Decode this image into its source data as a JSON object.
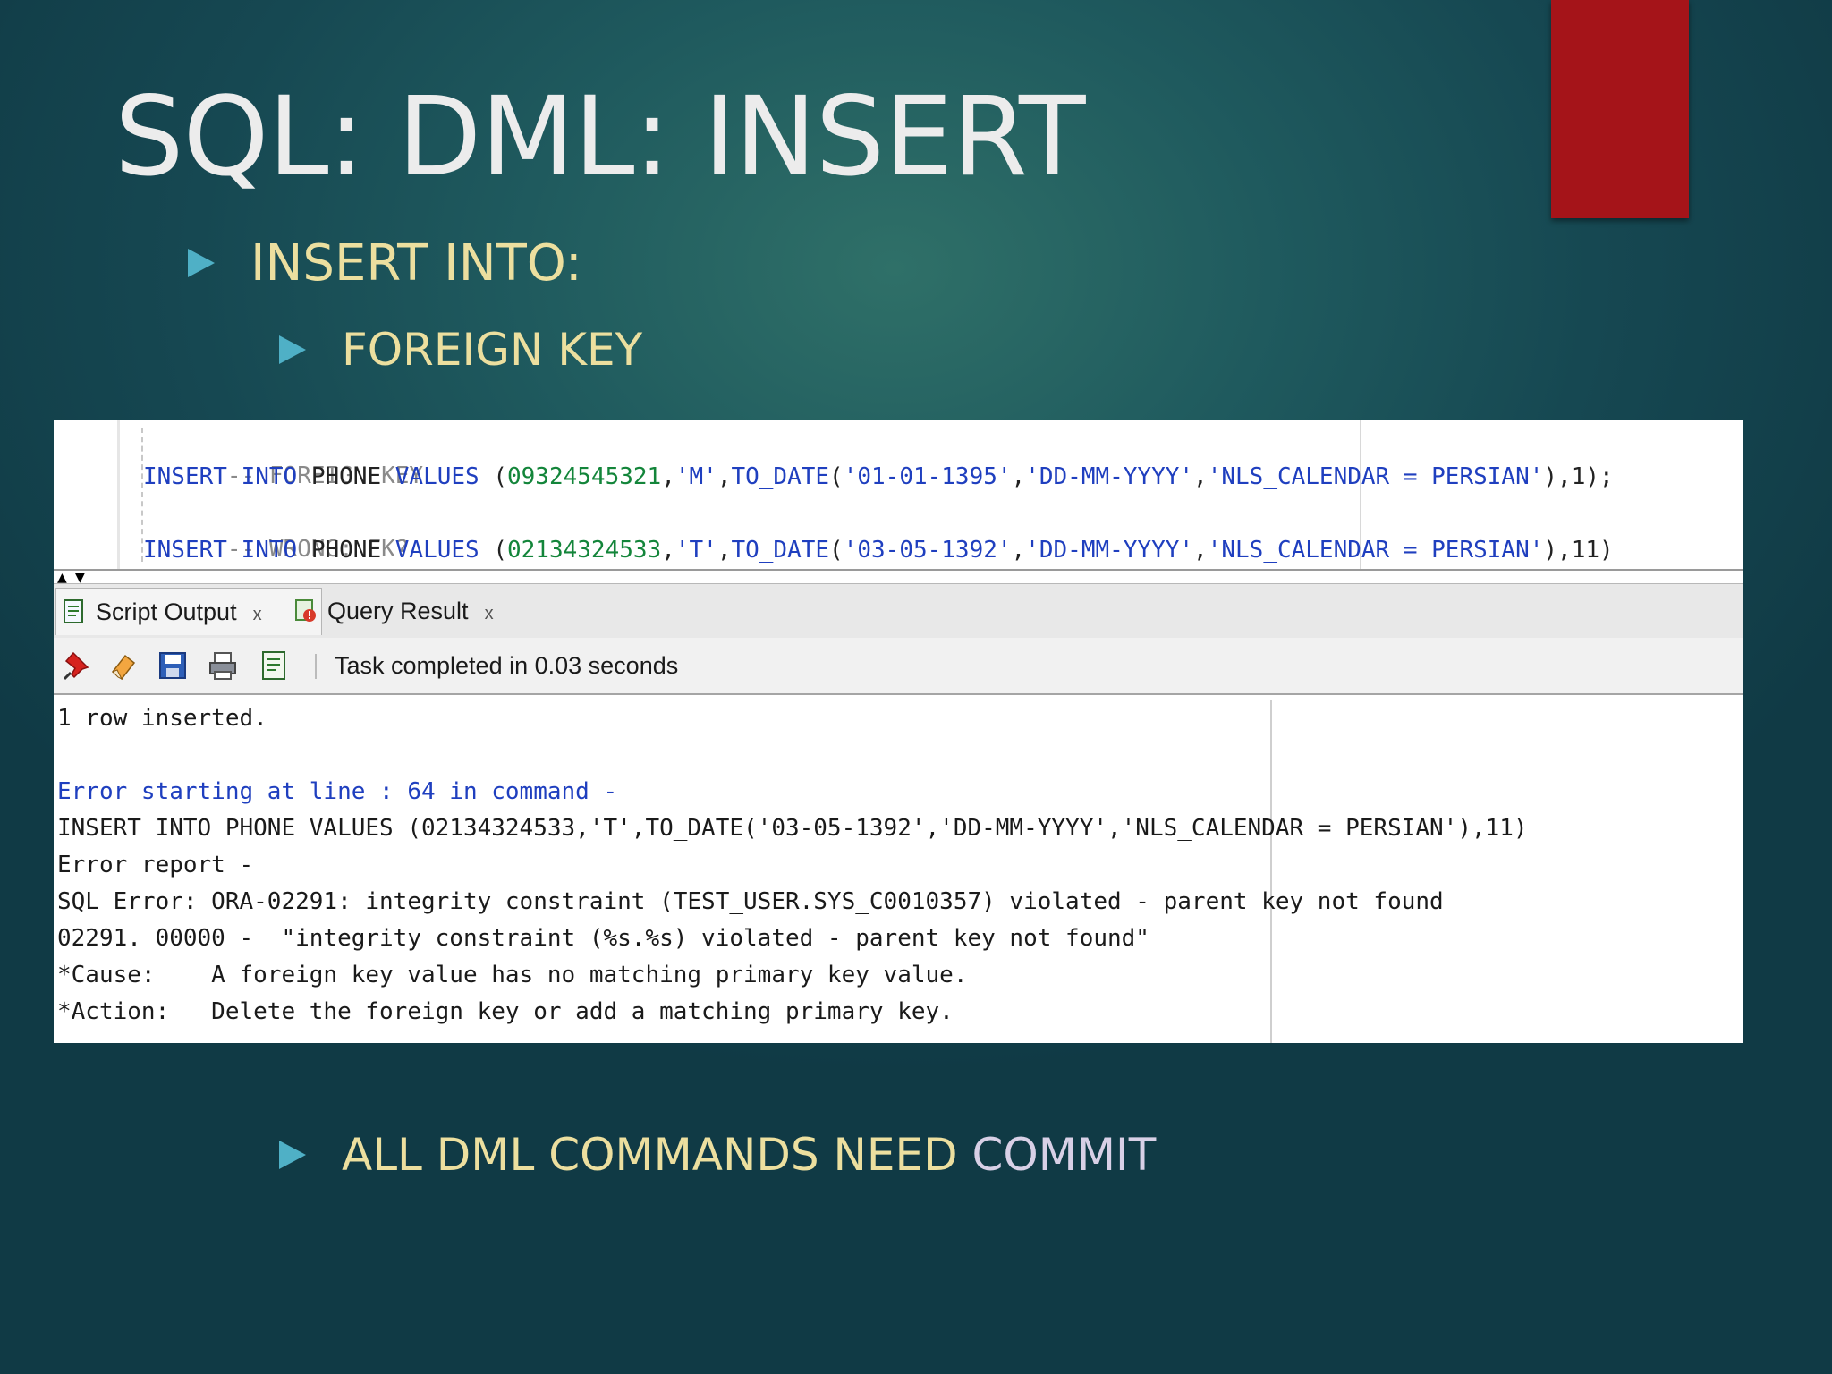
{
  "slide": {
    "title": "SQL: DML: INSERT",
    "bullets": {
      "level1": "INSERT INTO:",
      "level2": "FOREIGN KEY",
      "bottom_prefix": "ALL DML COMMANDS NEED ",
      "bottom_suffix": "COMMIT"
    }
  },
  "editor": {
    "lines": [
      {
        "comment": "-- FOREIGN KEY"
      },
      {
        "kw1": "INSERT INTO",
        "table": " PHONE ",
        "kw2": "VALUES",
        "open": " (",
        "num": "09324545321",
        "c1": ",",
        "s1": "'M'",
        "c2": ",",
        "fn": "TO_DATE",
        "p": "(",
        "s2": "'01-01-1395'",
        "c3": ",",
        "s3": "'DD-MM-YYYY'",
        "c4": ",",
        "s4": "'NLS_CALENDAR = PERSIAN'",
        "tail": "),1);"
      },
      {
        "comment": "-- WRONG: FK?"
      },
      {
        "kw1": "INSERT INTO",
        "table": " PHONE ",
        "kw2": "VALUES",
        "open": " (",
        "num": "02134324533",
        "c1": ",",
        "s1": "'T'",
        "c2": ",",
        "fn": "TO_DATE",
        "p": "(",
        "s2": "'03-05-1392'",
        "c3": ",",
        "s3": "'DD-MM-YYYY'",
        "c4": ",",
        "s4": "'NLS_CALENDAR = PERSIAN'",
        "tail": "),11)"
      }
    ]
  },
  "tabs": [
    {
      "label": "Script Output",
      "close": "x"
    },
    {
      "label": "Query Result",
      "close": "x"
    }
  ],
  "toolbar": {
    "icons": [
      "pin-icon",
      "eraser-icon",
      "save-icon",
      "print-icon",
      "export-icon"
    ],
    "status": "Task completed in 0.03 seconds"
  },
  "output": {
    "lines": [
      "1 row inserted.",
      "",
      "Error starting at line : 64 in command -",
      "INSERT INTO PHONE VALUES (02134324533,'T',TO_DATE('03-05-1392','DD-MM-YYYY','NLS_CALENDAR = PERSIAN'),11)",
      "Error report -",
      "SQL Error: ORA-02291: integrity constraint (TEST_USER.SYS_C0010357) violated - parent key not found",
      "02291. 00000 -  \"integrity constraint (%s.%s) violated - parent key not found\"",
      "*Cause:    A foreign key value has no matching primary key value.",
      "*Action:   Delete the foreign key or add a matching primary key."
    ]
  },
  "colors": {
    "accent_red": "#a51419",
    "bullet_text": "#ecdf9f",
    "bullet_marker": "#4fb0c6",
    "sql_keyword": "#1f3fbf",
    "sql_number": "#13853a",
    "sql_comment": "#8a8a8a"
  }
}
